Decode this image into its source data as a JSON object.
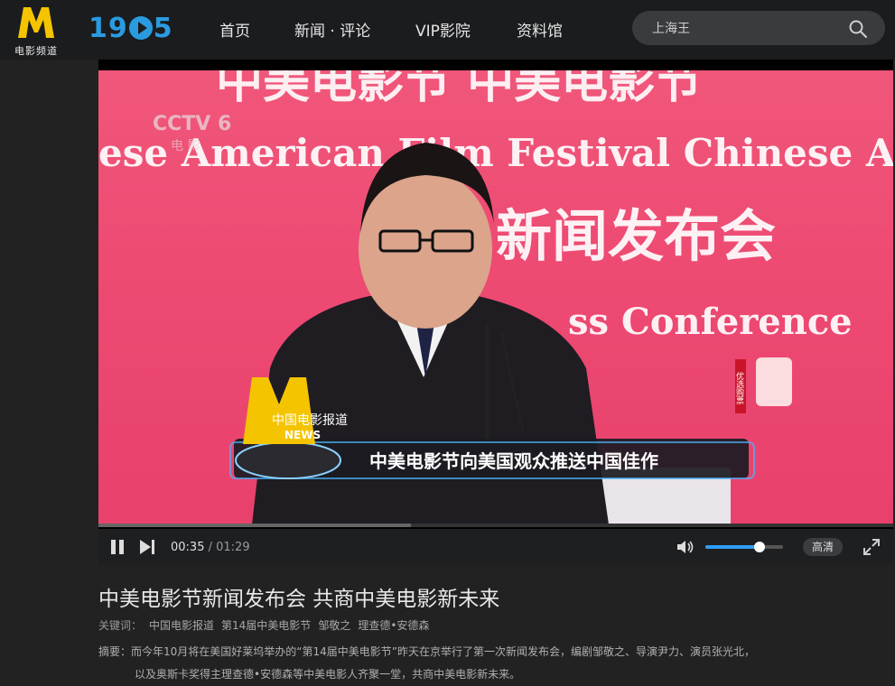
{
  "brand": {
    "logo_caption": "电影频道",
    "logo_1905_a": "19",
    "logo_1905_b": "5"
  },
  "nav": [
    "首页",
    "新闻 · 评论",
    "VIP影院",
    "资料馆"
  ],
  "search": {
    "value": "上海王",
    "icon": "search-icon"
  },
  "video": {
    "channel_logo": "CCTV 6",
    "channel_sub": "电 影",
    "bg_text_top": "中美电影节 中美电影节",
    "bg_text_en1": "ese American Film Festival  Chinese A",
    "bg_text_cn2": "新闻发布会",
    "bg_text_en2": "ss Conference",
    "program_name": "中国电影报道",
    "program_news": "NEWS",
    "caption": "中美电影节向美国观众推送中国佳作",
    "side_badge": "优选购票"
  },
  "controls": {
    "current_time": "00:35",
    "separator": " / ",
    "total_time": "01:29",
    "progress": 0.393,
    "volume": 0.7,
    "quality": "高清",
    "accent": "#2f9ef5"
  },
  "article": {
    "title": "中美电影节新闻发布会 共商中美电影新未来",
    "keywords_label": "关键词：",
    "keywords": [
      "中国电影报道",
      "第14届中美电影节",
      "邹敬之",
      "理查德•安德森"
    ],
    "summary_label": "摘要：",
    "summary_line1": "而今年10月将在美国好莱坞举办的“第14届中美电影节”昨天在京举行了第一次新闻发布会，编剧邹敬之、导演尹力、演员张光北，",
    "summary_line2": "以及奥斯卡奖得主理查德•安德森等中美电影人齐聚一堂，共商中美电影新未来。"
  }
}
